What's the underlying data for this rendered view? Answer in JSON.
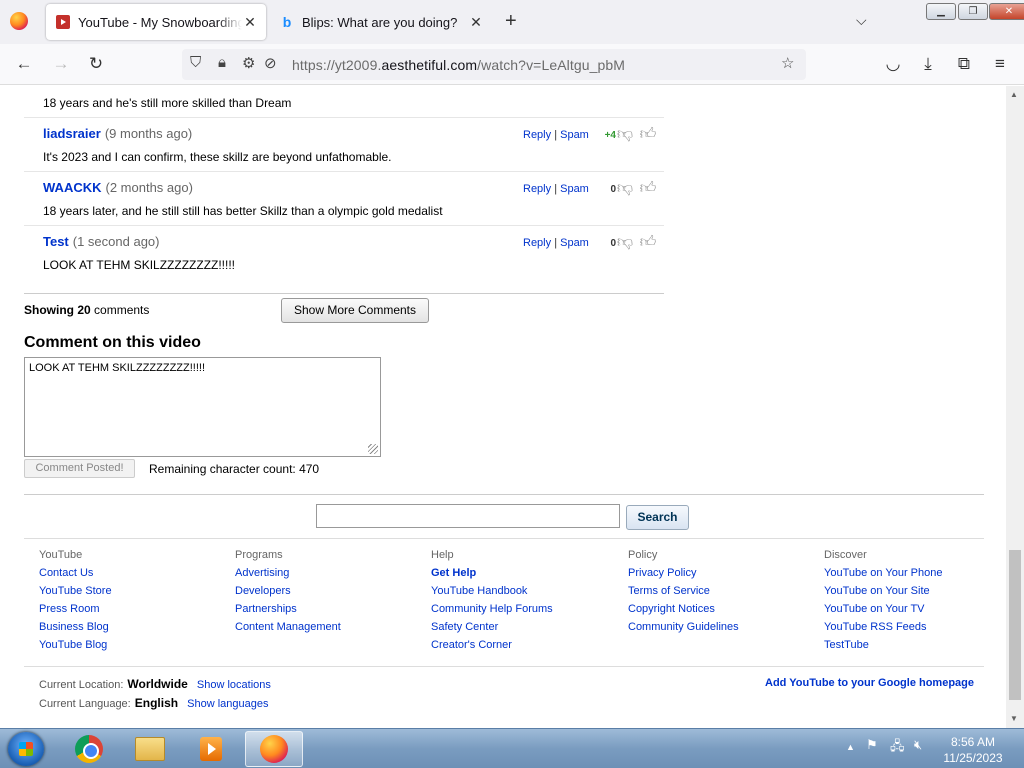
{
  "browser": {
    "tabs": [
      {
        "title": "YouTube - My Snowboarding Skillz",
        "close": "✕"
      },
      {
        "title": "Blips: What are you doing?",
        "close": "✕"
      }
    ],
    "url_prefix": "https://yt2009.",
    "url_domain": "aesthetiful.com",
    "url_suffix": "/watch?v=LeAltgu_pbM"
  },
  "comments": {
    "partial_top_text": "18 years and he's still more skilled than Dream",
    "items": [
      {
        "author": "liadsraier",
        "age": "(9 months ago)",
        "body": "It's 2023 and I can confirm, these skillz are beyond unfathomable.",
        "reply": "Reply",
        "spam": "Spam",
        "score": "+4"
      },
      {
        "author": "WAACKK",
        "age": "(2 months ago)",
        "body": "18 years later, and he still still has better Skillz than a olympic gold medalist",
        "reply": "Reply",
        "spam": "Spam",
        "score": "0"
      },
      {
        "author": "Test",
        "age": "(1 second ago)",
        "body": "LOOK AT TEHM SKILZZZZZZZZ!!!!!",
        "reply": "Reply",
        "spam": "Spam",
        "score": "0"
      }
    ],
    "showing_label": "Showing",
    "showing_count": "20",
    "showing_suffix": "comments",
    "show_more": "Show More Comments"
  },
  "comment_form": {
    "heading": "Comment on this video",
    "text": "LOOK AT TEHM SKILZZZZZZZZ!!!!!",
    "posted_button": "Comment Posted!",
    "remaining": "Remaining character count: 470"
  },
  "search": {
    "button": "Search",
    "value": ""
  },
  "footer": {
    "columns": [
      {
        "heading": "YouTube",
        "links": [
          "Contact Us",
          "YouTube Store",
          "Press Room",
          "Business Blog",
          "YouTube Blog"
        ]
      },
      {
        "heading": "Programs",
        "links": [
          "Advertising",
          "Developers",
          "Partnerships",
          "Content Management"
        ]
      },
      {
        "heading": "Help",
        "links": [
          "Get Help",
          "YouTube Handbook",
          "Community Help Forums",
          "Safety Center",
          "Creator's Corner"
        ]
      },
      {
        "heading": "Policy",
        "links": [
          "Privacy Policy",
          "Terms of Service",
          "Copyright Notices",
          "Community Guidelines"
        ]
      },
      {
        "heading": "Discover",
        "links": [
          "YouTube on Your Phone",
          "YouTube on Your Site",
          "YouTube on Your TV",
          "YouTube RSS Feeds",
          "TestTube"
        ]
      }
    ],
    "location_label": "Current Location:",
    "location_value": "Worldwide",
    "location_link": "Show locations",
    "language_label": "Current Language:",
    "language_value": "English",
    "language_link": "Show languages",
    "add_google": "Add YouTube to your Google homepage"
  },
  "taskbar": {
    "time": "8:56 AM",
    "date": "11/25/2023"
  },
  "colors": {
    "link": "#0033cc",
    "positive_score": "#339933"
  }
}
